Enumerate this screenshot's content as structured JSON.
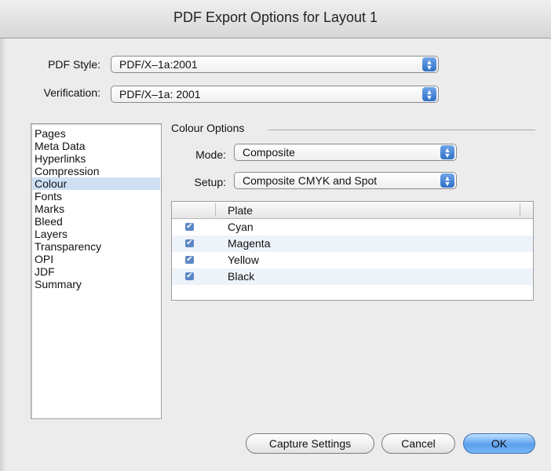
{
  "window": {
    "title": "PDF Export Options for Layout 1"
  },
  "pdf_style": {
    "label": "PDF Style:",
    "value": "PDF/X–1a:2001"
  },
  "verification": {
    "label": "Verification:",
    "value": "PDF/X–1a: 2001"
  },
  "sidebar": {
    "items": [
      {
        "label": "Pages"
      },
      {
        "label": "Meta Data"
      },
      {
        "label": "Hyperlinks"
      },
      {
        "label": "Compression"
      },
      {
        "label": "Colour",
        "selected": true
      },
      {
        "label": "Fonts"
      },
      {
        "label": "Marks"
      },
      {
        "label": "Bleed"
      },
      {
        "label": "Layers"
      },
      {
        "label": "Transparency"
      },
      {
        "label": "OPI"
      },
      {
        "label": "JDF"
      },
      {
        "label": "Summary"
      }
    ]
  },
  "colour_options": {
    "section_title": "Colour Options",
    "mode": {
      "label": "Mode:",
      "value": "Composite"
    },
    "setup": {
      "label": "Setup:",
      "value": "Composite CMYK and Spot"
    },
    "plates": {
      "header": "Plate",
      "rows": [
        {
          "name": "Cyan",
          "checked": true
        },
        {
          "name": "Magenta",
          "checked": true
        },
        {
          "name": "Yellow",
          "checked": true
        },
        {
          "name": "Black",
          "checked": true
        }
      ]
    }
  },
  "buttons": {
    "capture": "Capture Settings",
    "cancel": "Cancel",
    "ok": "OK"
  },
  "colors": {
    "accent": "#5aa0ef",
    "selection": "#cfe0f5"
  }
}
